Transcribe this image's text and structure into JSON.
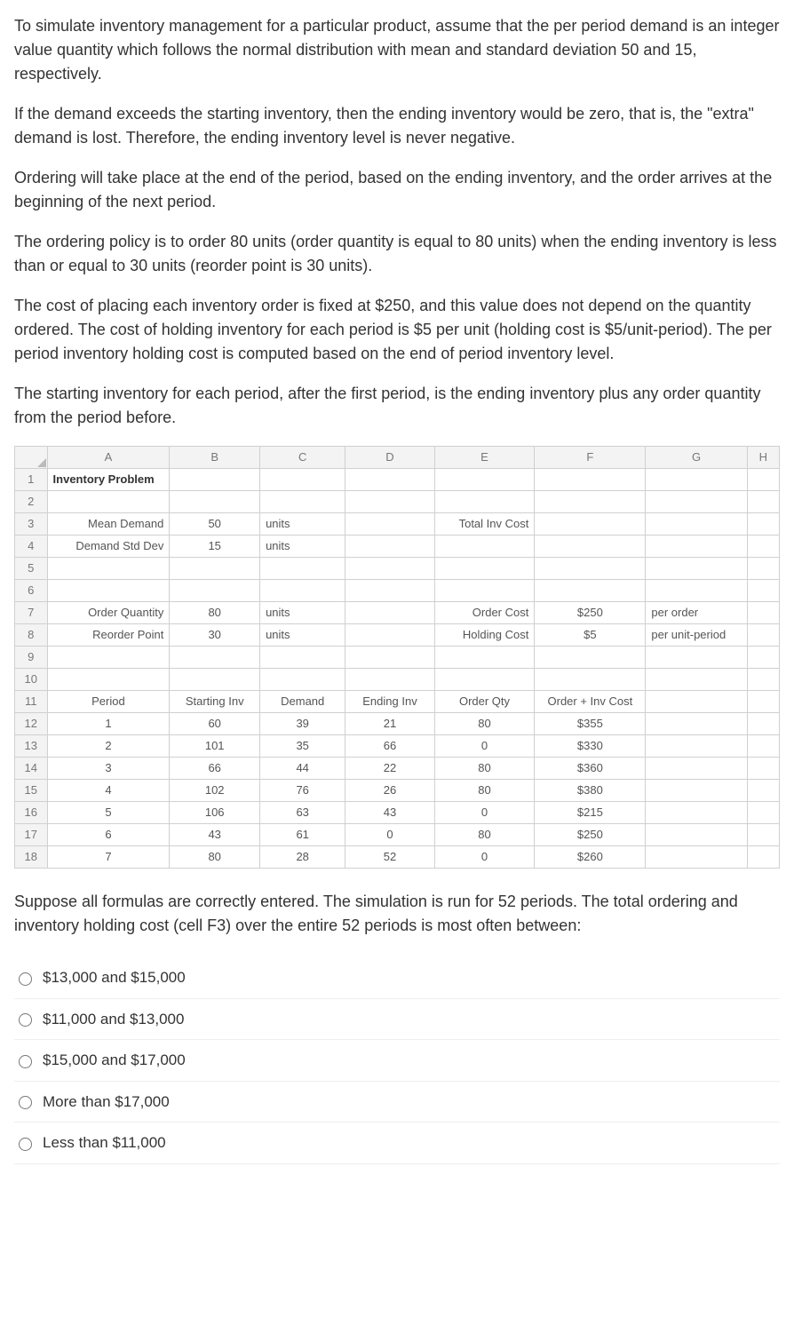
{
  "paragraphs": {
    "p1": "To simulate inventory management for a particular product, assume that the per period demand is an integer value quantity which follows the normal distribution with mean and standard deviation 50 and 15, respectively.",
    "p2": "If the demand exceeds the starting inventory, then the ending inventory would be zero, that is, the \"extra\" demand is lost.  Therefore, the ending inventory level is never negative.",
    "p3": "Ordering will take place at the end of the period, based on the ending inventory, and the order arrives at the beginning of the next period.",
    "p4": "The ordering policy is to order 80 units (order quantity is equal to 80 units) when the ending inventory is less than or equal to 30 units (reorder point is 30 units).",
    "p5": "The cost of placing each inventory order is fixed at $250, and this value does not depend on the quantity ordered.  The cost of holding inventory for each period is $5 per unit (holding cost is $5/unit-period).  The per period inventory holding cost is computed based on the end of period inventory level.",
    "p6": "The starting inventory for each period, after the first period, is the ending inventory plus any order quantity from the period before.",
    "p7": "Suppose all formulas are correctly entered.  The simulation is run for 52 periods.  The total ordering and inventory holding cost (cell F3) over the entire 52 periods is most often between:"
  },
  "sheet": {
    "cols": [
      "A",
      "B",
      "C",
      "D",
      "E",
      "F",
      "G",
      "H"
    ],
    "title": "Inventory Problem",
    "params": {
      "mean_label": "Mean Demand",
      "mean_val": "50",
      "mean_unit": "units",
      "sd_label": "Demand Std Dev",
      "sd_val": "15",
      "sd_unit": "units",
      "oq_label": "Order Quantity",
      "oq_val": "80",
      "oq_unit": "units",
      "rp_label": "Reorder Point",
      "rp_val": "30",
      "rp_unit": "units",
      "tic_label": "Total Inv Cost",
      "oc_label": "Order Cost",
      "oc_val": "$250",
      "oc_unit": "per order",
      "hc_label": "Holding Cost",
      "hc_val": "$5",
      "hc_unit": "per unit-period"
    },
    "headers": {
      "period": "Period",
      "start": "Starting Inv",
      "demand": "Demand",
      "end": "Ending Inv",
      "oqty": "Order Qty",
      "cost": "Order + Inv Cost"
    },
    "rows": [
      {
        "p": "1",
        "s": "60",
        "d": "39",
        "e": "21",
        "o": "80",
        "c": "$355"
      },
      {
        "p": "2",
        "s": "101",
        "d": "35",
        "e": "66",
        "o": "0",
        "c": "$330"
      },
      {
        "p": "3",
        "s": "66",
        "d": "44",
        "e": "22",
        "o": "80",
        "c": "$360"
      },
      {
        "p": "4",
        "s": "102",
        "d": "76",
        "e": "26",
        "o": "80",
        "c": "$380"
      },
      {
        "p": "5",
        "s": "106",
        "d": "63",
        "e": "43",
        "o": "0",
        "c": "$215"
      },
      {
        "p": "6",
        "s": "43",
        "d": "61",
        "e": "0",
        "o": "80",
        "c": "$250"
      },
      {
        "p": "7",
        "s": "80",
        "d": "28",
        "e": "52",
        "o": "0",
        "c": "$260"
      }
    ]
  },
  "answers": [
    "$13,000 and $15,000",
    "$11,000 and $13,000",
    "$15,000 and $17,000",
    "More than $17,000",
    "Less than $11,000"
  ]
}
